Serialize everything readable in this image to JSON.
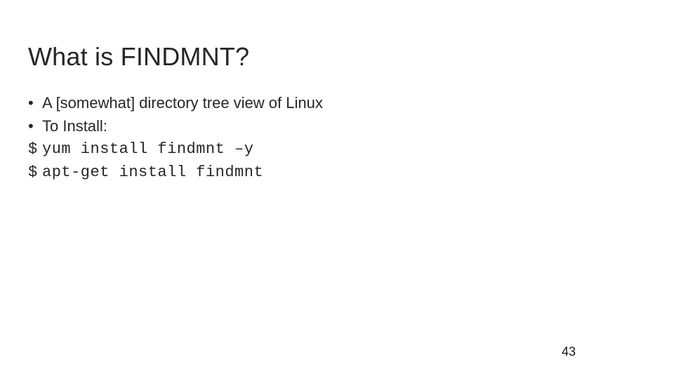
{
  "slide": {
    "title": "What is FINDMNT?",
    "lines": [
      {
        "marker": "•",
        "markerType": "bullet",
        "text": "A [somewhat] directory tree view of Linux",
        "mono": false
      },
      {
        "marker": "•",
        "markerType": "bullet",
        "text": "To Install:",
        "mono": false
      },
      {
        "marker": "$",
        "markerType": "prompt",
        "text": "yum install findmnt –y",
        "mono": true
      },
      {
        "marker": "$",
        "markerType": "prompt",
        "text": "apt-get install findmnt",
        "mono": true
      }
    ],
    "pageNumber": "43"
  }
}
